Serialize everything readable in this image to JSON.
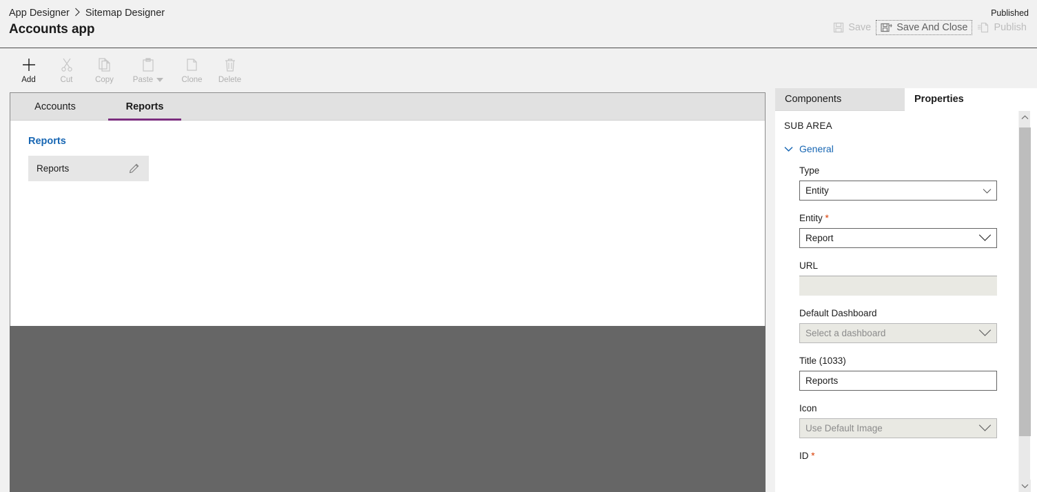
{
  "header": {
    "breadcrumb": [
      {
        "label": "App Designer"
      },
      {
        "label": "Sitemap Designer"
      }
    ],
    "separator": "›",
    "title": "Accounts app",
    "published_status": "Published",
    "actions": [
      {
        "name": "save",
        "label": "Save",
        "icon": "save-icon",
        "enabled": false,
        "focused": false
      },
      {
        "name": "save-and-close",
        "label": "Save And Close",
        "icon": "save-and-close-icon",
        "enabled": false,
        "focused": true
      },
      {
        "name": "publish",
        "label": "Publish",
        "icon": "publish-icon",
        "enabled": false,
        "focused": false
      }
    ]
  },
  "commandbar": {
    "items": [
      {
        "name": "add",
        "label": "Add",
        "icon": "plus-icon",
        "enabled": true
      },
      {
        "name": "cut",
        "label": "Cut",
        "icon": "scissors-icon",
        "enabled": false
      },
      {
        "name": "copy",
        "label": "Copy",
        "icon": "copy-icon",
        "enabled": false
      },
      {
        "name": "paste",
        "label": "Paste",
        "icon": "paste-icon",
        "enabled": false,
        "has_caret": true
      },
      {
        "name": "clone",
        "label": "Clone",
        "icon": "clone-icon",
        "enabled": false
      },
      {
        "name": "delete",
        "label": "Delete",
        "icon": "trash-icon",
        "enabled": false
      }
    ]
  },
  "canvas": {
    "tabs": [
      {
        "label": "Accounts",
        "active": false
      },
      {
        "label": "Reports",
        "active": true
      }
    ],
    "accent_color": "#7b2d7e",
    "group_title": "Reports",
    "subarea_tile": {
      "label": "Reports",
      "edit_icon": "pencil-icon"
    }
  },
  "right_panel": {
    "tabs": [
      {
        "label": "Components",
        "active": false
      },
      {
        "label": "Properties",
        "active": true
      }
    ],
    "section_header": "SUB AREA",
    "group": {
      "label": "General",
      "expanded": true,
      "color": "#1766b3"
    },
    "fields": [
      {
        "name": "type",
        "label": "Type",
        "required": false,
        "control": "dropdown",
        "value": "Entity",
        "placeholder": "",
        "disabled": false
      },
      {
        "name": "entity",
        "label": "Entity",
        "required": true,
        "control": "dropdown",
        "value": "Report",
        "placeholder": "",
        "disabled": false
      },
      {
        "name": "url",
        "label": "URL",
        "required": false,
        "control": "text",
        "value": "",
        "placeholder": "",
        "disabled": true
      },
      {
        "name": "default-dashboard",
        "label": "Default Dashboard",
        "required": false,
        "control": "dropdown",
        "value": "",
        "placeholder": "Select a dashboard",
        "disabled": true
      },
      {
        "name": "title",
        "label": "Title (1033)",
        "required": false,
        "control": "text",
        "value": "Reports",
        "placeholder": "",
        "disabled": false
      },
      {
        "name": "icon",
        "label": "Icon",
        "required": false,
        "control": "dropdown",
        "value": "",
        "placeholder": "Use Default Image",
        "disabled": true
      },
      {
        "name": "id",
        "label": "ID",
        "required": true,
        "control": "none",
        "value": "",
        "placeholder": "",
        "disabled": false
      }
    ],
    "required_marker": "*",
    "scrollbar": {
      "up_icon": "chevron-up-icon",
      "down_icon": "chevron-down-icon"
    }
  }
}
